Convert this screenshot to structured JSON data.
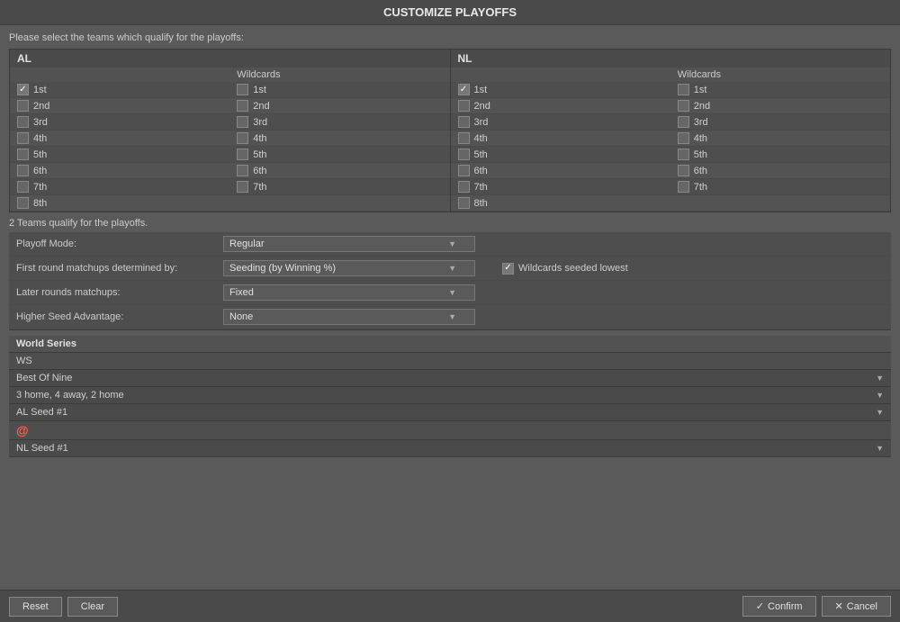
{
  "title": "CUSTOMIZE PLAYOFFS",
  "instruction": "Please select the teams which qualify for the playoffs:",
  "leagues": [
    {
      "name": "AL",
      "seeds": [
        {
          "label": "1st",
          "main_checked": true,
          "wild_checked": false
        },
        {
          "label": "2nd",
          "main_checked": false,
          "wild_checked": false
        },
        {
          "label": "3rd",
          "main_checked": false,
          "wild_checked": false
        },
        {
          "label": "4th",
          "main_checked": false,
          "wild_checked": false
        },
        {
          "label": "5th",
          "main_checked": false,
          "wild_checked": false
        },
        {
          "label": "6th",
          "main_checked": false,
          "wild_checked": false
        },
        {
          "label": "7th",
          "main_checked": false,
          "wild_checked": false
        },
        {
          "label": "8th",
          "main_checked": false,
          "wild_checked": false
        }
      ]
    },
    {
      "name": "NL",
      "seeds": [
        {
          "label": "1st",
          "main_checked": true,
          "wild_checked": false
        },
        {
          "label": "2nd",
          "main_checked": false,
          "wild_checked": false
        },
        {
          "label": "3rd",
          "main_checked": false,
          "wild_checked": false
        },
        {
          "label": "4th",
          "main_checked": false,
          "wild_checked": false
        },
        {
          "label": "5th",
          "main_checked": false,
          "wild_checked": false
        },
        {
          "label": "6th",
          "main_checked": false,
          "wild_checked": false
        },
        {
          "label": "7th",
          "main_checked": false,
          "wild_checked": false
        },
        {
          "label": "8th",
          "main_checked": false,
          "wild_checked": false
        }
      ]
    }
  ],
  "wildcards_label": "Wildcards",
  "qualify_text": "2 Teams qualify for the playoffs.",
  "settings": {
    "playoff_mode": {
      "label": "Playoff Mode:",
      "value": "Regular"
    },
    "first_round": {
      "label": "First round matchups determined by:",
      "value": "Seeding (by Winning %)"
    },
    "later_rounds": {
      "label": "Later rounds matchups:",
      "value": "Fixed"
    },
    "higher_seed": {
      "label": "Higher Seed Advantage:",
      "value": "None"
    },
    "wildcards_seeded": {
      "label": "Wildcards seeded lowest",
      "checked": true
    }
  },
  "series": {
    "header": "World Series",
    "abbreviation": "WS",
    "best_of": "Best Of Nine",
    "format": "3 home, 4 away, 2 home",
    "team1": "AL Seed #1",
    "at_symbol": "@",
    "team2": "NL Seed #1"
  },
  "footer": {
    "reset_label": "Reset",
    "clear_label": "Clear",
    "confirm_label": "Confirm",
    "cancel_label": "Cancel"
  }
}
